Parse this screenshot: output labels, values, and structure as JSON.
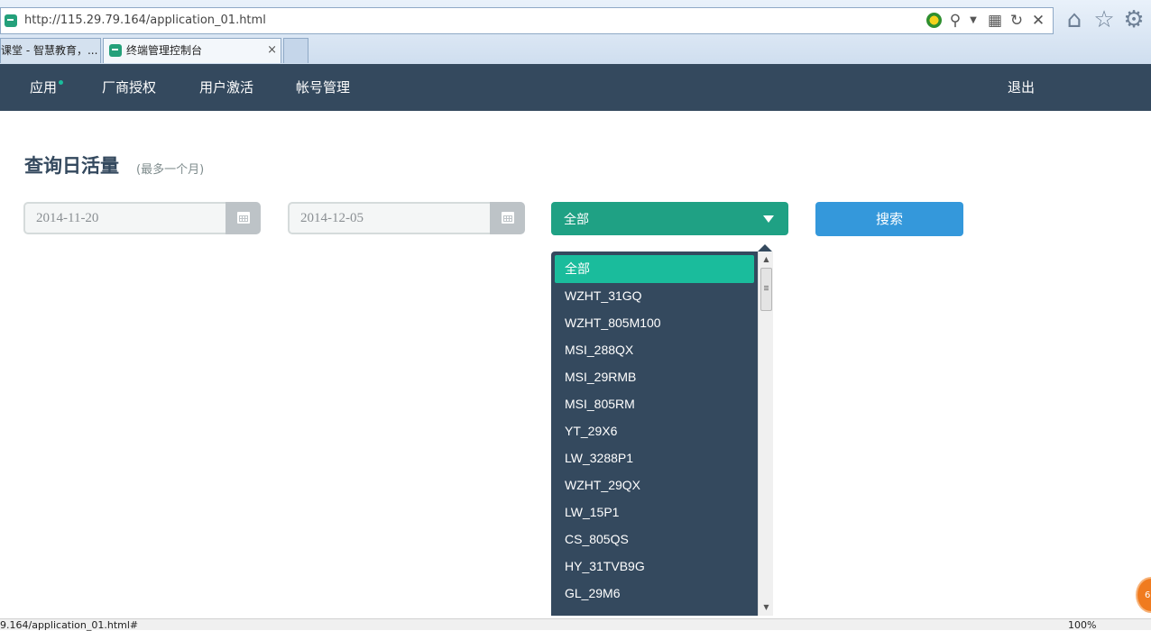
{
  "browser": {
    "url": "http://115.29.79.164/application_01.html",
    "tabs": [
      {
        "title": "课堂 - 智慧教育，...",
        "active": false
      },
      {
        "title": "终端管理控制台",
        "active": true
      }
    ],
    "tab_close": "×",
    "icons": [
      "compatibility-icon",
      "search-icon",
      "dropdown-icon",
      "page-icon",
      "refresh-icon",
      "stop-icon",
      "home-icon",
      "favorites-icon",
      "tools-icon"
    ],
    "status_url": "9.164/application_01.html#",
    "zoom": "100%",
    "badge": "6"
  },
  "navbar": {
    "items": [
      {
        "label": "应用",
        "dot": true
      },
      {
        "label": "厂商授权"
      },
      {
        "label": "用户激活"
      },
      {
        "label": "帐号管理"
      }
    ],
    "logout": "退出"
  },
  "main": {
    "title": "查询日活量",
    "subtitle": "(最多一个月)",
    "start_date": "2014-11-20",
    "end_date": "2014-12-05",
    "select_value": "全部",
    "search_label": "搜索",
    "dropdown_options": [
      "全部",
      "WZHT_31GQ",
      "WZHT_805M100",
      "MSI_288QX",
      "MSI_29RMB",
      "MSI_805RM",
      "YT_29X6",
      "LW_3288P1",
      "WZHT_29QX",
      "LW_15P1",
      "CS_805QS",
      "HY_31TVB9G",
      "GL_29M6"
    ],
    "selected_option": "全部"
  },
  "colors": {
    "navbar": "#34495e",
    "accent_green": "#1abc9c",
    "select_green": "#1fa184",
    "search_blue": "#3498db"
  }
}
